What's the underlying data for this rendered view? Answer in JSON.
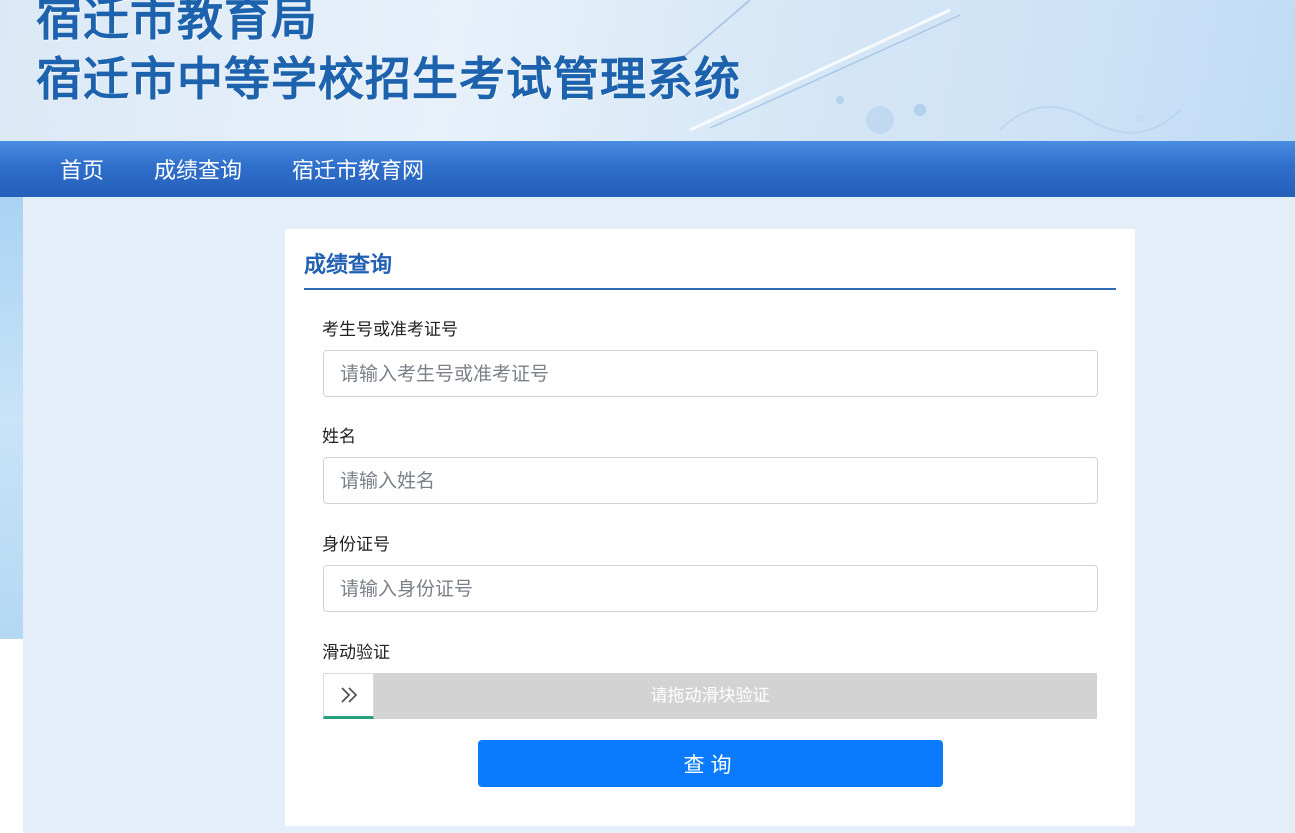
{
  "header": {
    "title_line1": "宿迁市教育局",
    "title_line2": "宿迁市中等学校招生考试管理系统"
  },
  "nav": {
    "items": [
      {
        "label": "首页"
      },
      {
        "label": "成绩查询"
      },
      {
        "label": "宿迁市教育网"
      }
    ]
  },
  "form": {
    "title": "成绩查询",
    "exam_id": {
      "label": "考生号或准考证号",
      "placeholder": "请输入考生号或准考证号",
      "value": ""
    },
    "name": {
      "label": "姓名",
      "placeholder": "请输入姓名",
      "value": ""
    },
    "id_card": {
      "label": "身份证号",
      "placeholder": "请输入身份证号",
      "value": ""
    },
    "slider": {
      "label": "滑动验证",
      "hint": "请拖动滑块验证",
      "handle_icon": "double-chevron-right-icon"
    },
    "submit_label": "查询"
  },
  "colors": {
    "nav_bg": "#2f6fcc",
    "title_blue": "#1c62ad",
    "button_blue": "#0a7bfe",
    "slider_gray": "#d3d3d3",
    "slider_accent": "#27a07e"
  }
}
